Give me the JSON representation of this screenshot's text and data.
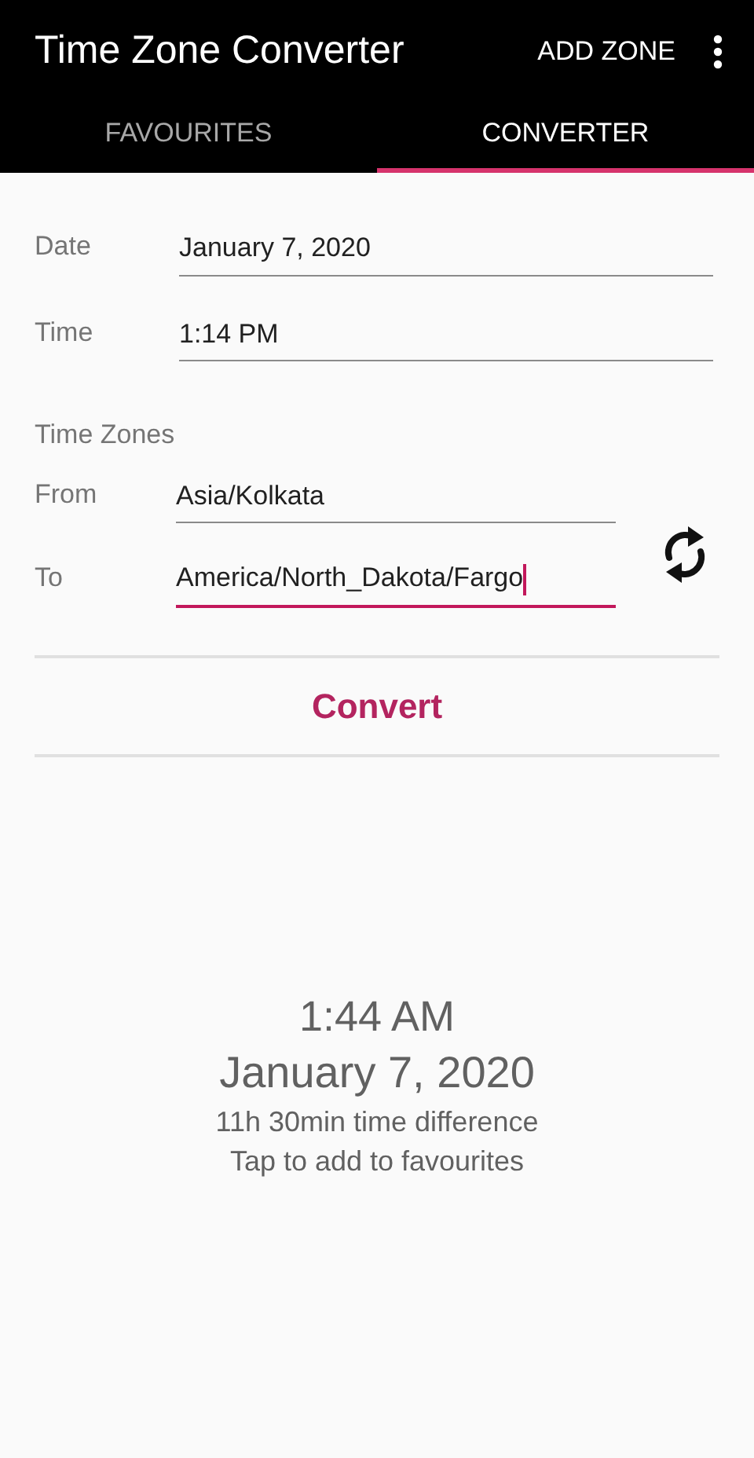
{
  "app_bar": {
    "title": "Time Zone Converter",
    "action": "ADD ZONE"
  },
  "tabs": [
    {
      "label": "FAVOURITES",
      "selected": false
    },
    {
      "label": "CONVERTER",
      "selected": true
    }
  ],
  "fields": [
    {
      "label": "Date",
      "value": "January 7, 2020"
    },
    {
      "label": "Time",
      "value": "1:14 PM"
    }
  ],
  "time_zones": {
    "heading": "Time Zones",
    "fields": [
      {
        "label": "From",
        "value": "Asia/Kolkata",
        "focused": false
      },
      {
        "label": "To",
        "value": "America/North_Dakota/Fargo",
        "focused": true
      }
    ]
  },
  "convert_button": "Convert",
  "result": {
    "time": "1:44 AM",
    "date": "January 7, 2020",
    "difference": "11h 30min time difference",
    "hint": "Tap to add to favourites"
  }
}
